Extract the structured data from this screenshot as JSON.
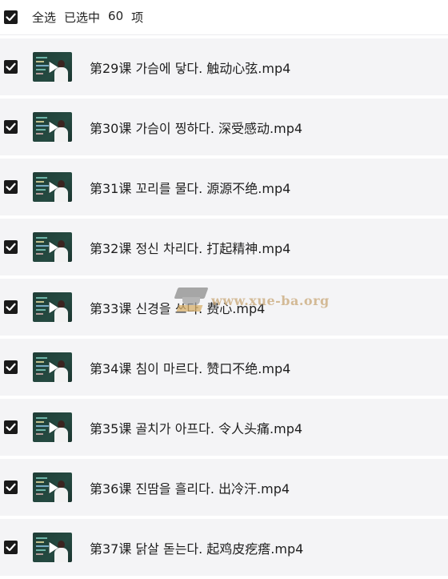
{
  "header": {
    "select_all_label": "全选",
    "selected_prefix": "已选中",
    "selected_count": "60",
    "selected_suffix": "项"
  },
  "items": [
    {
      "title": "第29课 가슴에 닿다. 触动心弦.mp4",
      "checked": true
    },
    {
      "title": "第30课 가슴이 찡하다. 深受感动.mp4",
      "checked": true
    },
    {
      "title": "第31课 꼬리를 물다. 源源不绝.mp4",
      "checked": true
    },
    {
      "title": "第32课 정신 차리다. 打起精神.mp4",
      "checked": true
    },
    {
      "title": "第33课 신경을 쓰다. 费心.mp4",
      "checked": true
    },
    {
      "title": "第34课 침이 마르다. 赞口不绝.mp4",
      "checked": true
    },
    {
      "title": "第35课 골치가 아프다. 令人头痛.mp4",
      "checked": true
    },
    {
      "title": "第36课 진땀을 흘리다. 出冷汗.mp4",
      "checked": true
    },
    {
      "title": "第37课 닭살 돋는다. 起鸡皮疙瘩.mp4",
      "checked": true
    }
  ],
  "watermark": {
    "text": "www.xue-ba.org"
  },
  "colors": {
    "row_bg": "#f4f4f6",
    "checkbox": "#1a1a1a",
    "watermark": "#c9a777"
  }
}
